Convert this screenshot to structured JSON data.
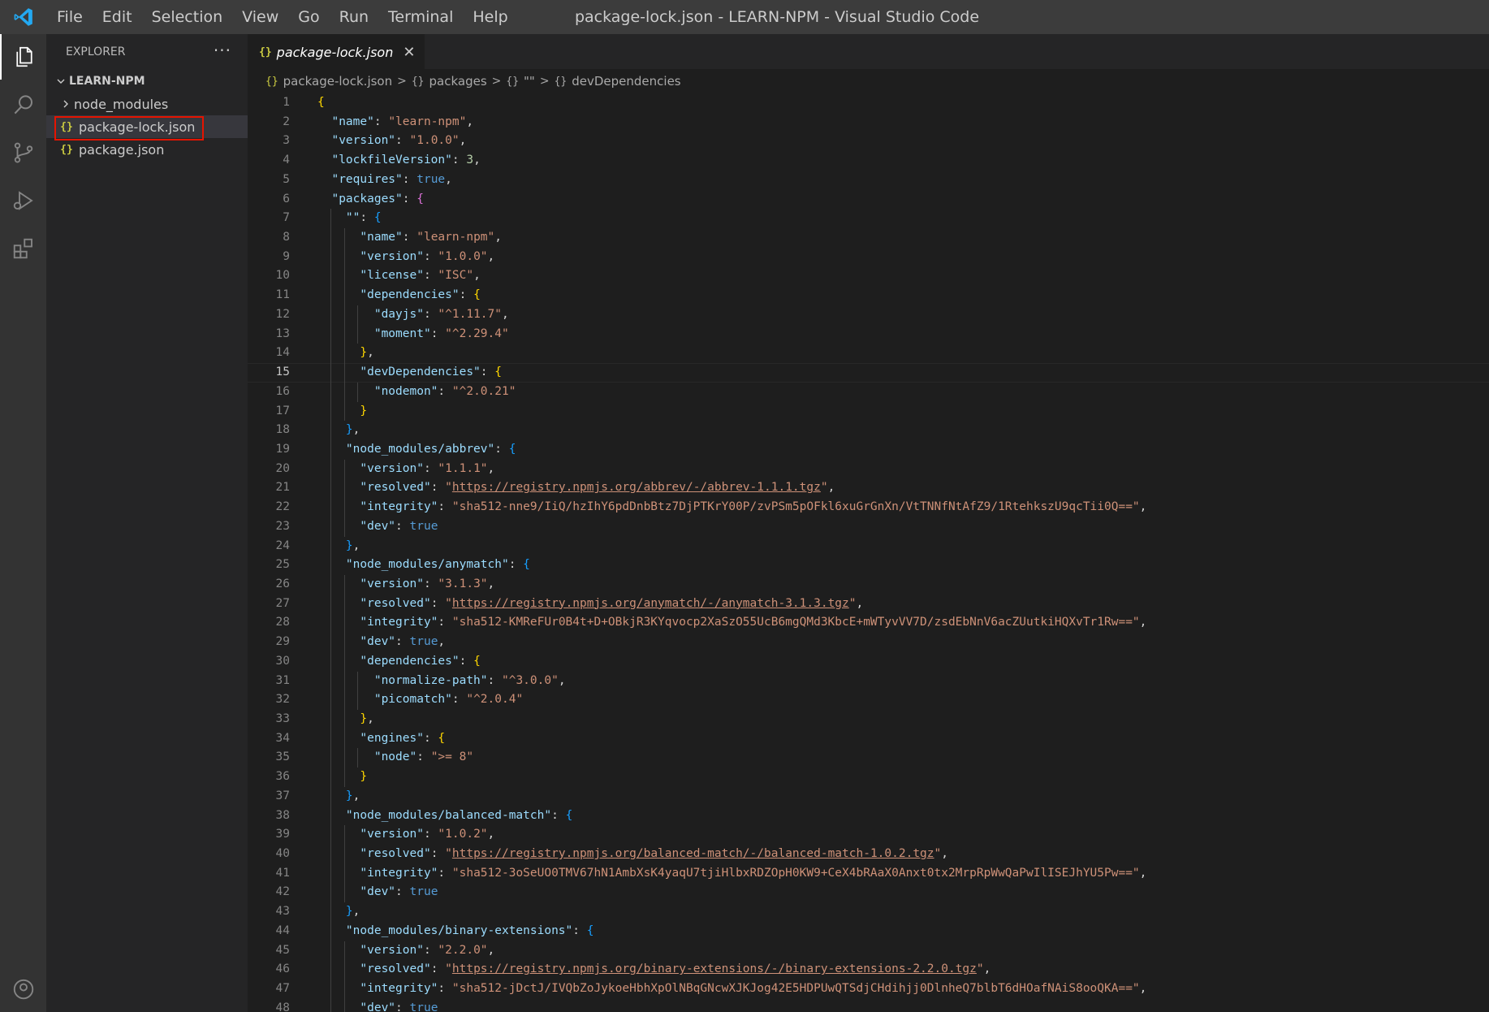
{
  "window": {
    "title": "package-lock.json - LEARN-NPM - Visual Studio Code",
    "menu": [
      "File",
      "Edit",
      "Selection",
      "View",
      "Go",
      "Run",
      "Terminal",
      "Help"
    ]
  },
  "sidebar": {
    "header": "EXPLORER",
    "more": "···",
    "root": "LEARN-NPM",
    "items": [
      {
        "label": "node_modules",
        "type": "folder"
      },
      {
        "label": "package-lock.json",
        "type": "json",
        "selected": true
      },
      {
        "label": "package.json",
        "type": "json"
      }
    ]
  },
  "tab": {
    "label": "package-lock.json",
    "icon": "{}",
    "close": "✕"
  },
  "breadcrumb": [
    "package-lock.json",
    "packages",
    "\"\"",
    "devDependencies"
  ],
  "editor": {
    "current_line": 15,
    "lines": [
      [
        [
          "br1",
          "{"
        ]
      ],
      [
        [
          "k",
          "  \"name\""
        ],
        [
          "p",
          ": "
        ],
        [
          "s",
          "\"learn-npm\""
        ],
        [
          "p",
          ","
        ]
      ],
      [
        [
          "k",
          "  \"version\""
        ],
        [
          "p",
          ": "
        ],
        [
          "s",
          "\"1.0.0\""
        ],
        [
          "p",
          ","
        ]
      ],
      [
        [
          "k",
          "  \"lockfileVersion\""
        ],
        [
          "p",
          ": "
        ],
        [
          "n",
          "3"
        ],
        [
          "p",
          ","
        ]
      ],
      [
        [
          "k",
          "  \"requires\""
        ],
        [
          "p",
          ": "
        ],
        [
          "b",
          "true"
        ],
        [
          "p",
          ","
        ]
      ],
      [
        [
          "k",
          "  \"packages\""
        ],
        [
          "p",
          ": "
        ],
        [
          "br2",
          "{"
        ]
      ],
      [
        [
          "k",
          "    \"\""
        ],
        [
          "p",
          ": "
        ],
        [
          "br3",
          "{"
        ]
      ],
      [
        [
          "k",
          "      \"name\""
        ],
        [
          "p",
          ": "
        ],
        [
          "s",
          "\"learn-npm\""
        ],
        [
          "p",
          ","
        ]
      ],
      [
        [
          "k",
          "      \"version\""
        ],
        [
          "p",
          ": "
        ],
        [
          "s",
          "\"1.0.0\""
        ],
        [
          "p",
          ","
        ]
      ],
      [
        [
          "k",
          "      \"license\""
        ],
        [
          "p",
          ": "
        ],
        [
          "s",
          "\"ISC\""
        ],
        [
          "p",
          ","
        ]
      ],
      [
        [
          "k",
          "      \"dependencies\""
        ],
        [
          "p",
          ": "
        ],
        [
          "br1",
          "{"
        ]
      ],
      [
        [
          "k",
          "        \"dayjs\""
        ],
        [
          "p",
          ": "
        ],
        [
          "s",
          "\"^1.11.7\""
        ],
        [
          "p",
          ","
        ]
      ],
      [
        [
          "k",
          "        \"moment\""
        ],
        [
          "p",
          ": "
        ],
        [
          "s",
          "\"^2.29.4\""
        ]
      ],
      [
        [
          "br1",
          "      }"
        ],
        [
          "p",
          ","
        ]
      ],
      [
        [
          "k",
          "      \"devDependencies\""
        ],
        [
          "p",
          ": "
        ],
        [
          "br1",
          "{"
        ]
      ],
      [
        [
          "k",
          "        \"nodemon\""
        ],
        [
          "p",
          ": "
        ],
        [
          "s",
          "\"^2.0.21\""
        ]
      ],
      [
        [
          "br1",
          "      }"
        ]
      ],
      [
        [
          "br3",
          "    }"
        ],
        [
          "p",
          ","
        ]
      ],
      [
        [
          "k",
          "    \"node_modules/abbrev\""
        ],
        [
          "p",
          ": "
        ],
        [
          "br3",
          "{"
        ]
      ],
      [
        [
          "k",
          "      \"version\""
        ],
        [
          "p",
          ": "
        ],
        [
          "s",
          "\"1.1.1\""
        ],
        [
          "p",
          ","
        ]
      ],
      [
        [
          "k",
          "      \"resolved\""
        ],
        [
          "p",
          ": "
        ],
        [
          "s",
          "\""
        ],
        [
          "u",
          "https://registry.npmjs.org/abbrev/-/abbrev-1.1.1.tgz"
        ],
        [
          "s",
          "\""
        ],
        [
          "p",
          ","
        ]
      ],
      [
        [
          "k",
          "      \"integrity\""
        ],
        [
          "p",
          ": "
        ],
        [
          "s",
          "\"sha512-nne9/IiQ/hzIhY6pdDnbBtz7DjPTKrY00P/zvPSm5pOFkl6xuGrGnXn/VtTNNfNtAfZ9/1RtehkszU9qcTii0Q==\""
        ],
        [
          "p",
          ","
        ]
      ],
      [
        [
          "k",
          "      \"dev\""
        ],
        [
          "p",
          ": "
        ],
        [
          "b",
          "true"
        ]
      ],
      [
        [
          "br3",
          "    }"
        ],
        [
          "p",
          ","
        ]
      ],
      [
        [
          "k",
          "    \"node_modules/anymatch\""
        ],
        [
          "p",
          ": "
        ],
        [
          "br3",
          "{"
        ]
      ],
      [
        [
          "k",
          "      \"version\""
        ],
        [
          "p",
          ": "
        ],
        [
          "s",
          "\"3.1.3\""
        ],
        [
          "p",
          ","
        ]
      ],
      [
        [
          "k",
          "      \"resolved\""
        ],
        [
          "p",
          ": "
        ],
        [
          "s",
          "\""
        ],
        [
          "u",
          "https://registry.npmjs.org/anymatch/-/anymatch-3.1.3.tgz"
        ],
        [
          "s",
          "\""
        ],
        [
          "p",
          ","
        ]
      ],
      [
        [
          "k",
          "      \"integrity\""
        ],
        [
          "p",
          ": "
        ],
        [
          "s",
          "\"sha512-KMReFUr0B4t+D+OBkjR3KYqvocp2XaSzO55UcB6mgQMd3KbcE+mWTyvVV7D/zsdEbNnV6acZUutkiHQXvTr1Rw==\""
        ],
        [
          "p",
          ","
        ]
      ],
      [
        [
          "k",
          "      \"dev\""
        ],
        [
          "p",
          ": "
        ],
        [
          "b",
          "true"
        ],
        [
          "p",
          ","
        ]
      ],
      [
        [
          "k",
          "      \"dependencies\""
        ],
        [
          "p",
          ": "
        ],
        [
          "br1",
          "{"
        ]
      ],
      [
        [
          "k",
          "        \"normalize-path\""
        ],
        [
          "p",
          ": "
        ],
        [
          "s",
          "\"^3.0.0\""
        ],
        [
          "p",
          ","
        ]
      ],
      [
        [
          "k",
          "        \"picomatch\""
        ],
        [
          "p",
          ": "
        ],
        [
          "s",
          "\"^2.0.4\""
        ]
      ],
      [
        [
          "br1",
          "      }"
        ],
        [
          "p",
          ","
        ]
      ],
      [
        [
          "k",
          "      \"engines\""
        ],
        [
          "p",
          ": "
        ],
        [
          "br1",
          "{"
        ]
      ],
      [
        [
          "k",
          "        \"node\""
        ],
        [
          "p",
          ": "
        ],
        [
          "s",
          "\">= 8\""
        ]
      ],
      [
        [
          "br1",
          "      }"
        ]
      ],
      [
        [
          "br3",
          "    }"
        ],
        [
          "p",
          ","
        ]
      ],
      [
        [
          "k",
          "    \"node_modules/balanced-match\""
        ],
        [
          "p",
          ": "
        ],
        [
          "br3",
          "{"
        ]
      ],
      [
        [
          "k",
          "      \"version\""
        ],
        [
          "p",
          ": "
        ],
        [
          "s",
          "\"1.0.2\""
        ],
        [
          "p",
          ","
        ]
      ],
      [
        [
          "k",
          "      \"resolved\""
        ],
        [
          "p",
          ": "
        ],
        [
          "s",
          "\""
        ],
        [
          "u",
          "https://registry.npmjs.org/balanced-match/-/balanced-match-1.0.2.tgz"
        ],
        [
          "s",
          "\""
        ],
        [
          "p",
          ","
        ]
      ],
      [
        [
          "k",
          "      \"integrity\""
        ],
        [
          "p",
          ": "
        ],
        [
          "s",
          "\"sha512-3oSeUO0TMV67hN1AmbXsK4yaqU7tjiHlbxRDZOpH0KW9+CeX4bRAaX0Anxt0tx2MrpRpWwQaPwIlISEJhYU5Pw==\""
        ],
        [
          "p",
          ","
        ]
      ],
      [
        [
          "k",
          "      \"dev\""
        ],
        [
          "p",
          ": "
        ],
        [
          "b",
          "true"
        ]
      ],
      [
        [
          "br3",
          "    }"
        ],
        [
          "p",
          ","
        ]
      ],
      [
        [
          "k",
          "    \"node_modules/binary-extensions\""
        ],
        [
          "p",
          ": "
        ],
        [
          "br3",
          "{"
        ]
      ],
      [
        [
          "k",
          "      \"version\""
        ],
        [
          "p",
          ": "
        ],
        [
          "s",
          "\"2.2.0\""
        ],
        [
          "p",
          ","
        ]
      ],
      [
        [
          "k",
          "      \"resolved\""
        ],
        [
          "p",
          ": "
        ],
        [
          "s",
          "\""
        ],
        [
          "u",
          "https://registry.npmjs.org/binary-extensions/-/binary-extensions-2.2.0.tgz"
        ],
        [
          "s",
          "\""
        ],
        [
          "p",
          ","
        ]
      ],
      [
        [
          "k",
          "      \"integrity\""
        ],
        [
          "p",
          ": "
        ],
        [
          "s",
          "\"sha512-jDctJ/IVQbZoJykoeHbhXpOlNBqGNcwXJKJog42E5HDPUwQTSdjCHdihjj0DlnheQ7blbT6dHOafNAiS8ooQKA==\""
        ],
        [
          "p",
          ","
        ]
      ],
      [
        [
          "k",
          "      \"dev\""
        ],
        [
          "p",
          ": "
        ],
        [
          "b",
          "true"
        ]
      ]
    ]
  },
  "colors": {
    "titlebar": "#3c3c3c",
    "activitybar": "#333333",
    "sidebar": "#252526",
    "editor": "#1e1e1e",
    "accent": "#0078d4",
    "highlight_box": "#e51400"
  }
}
